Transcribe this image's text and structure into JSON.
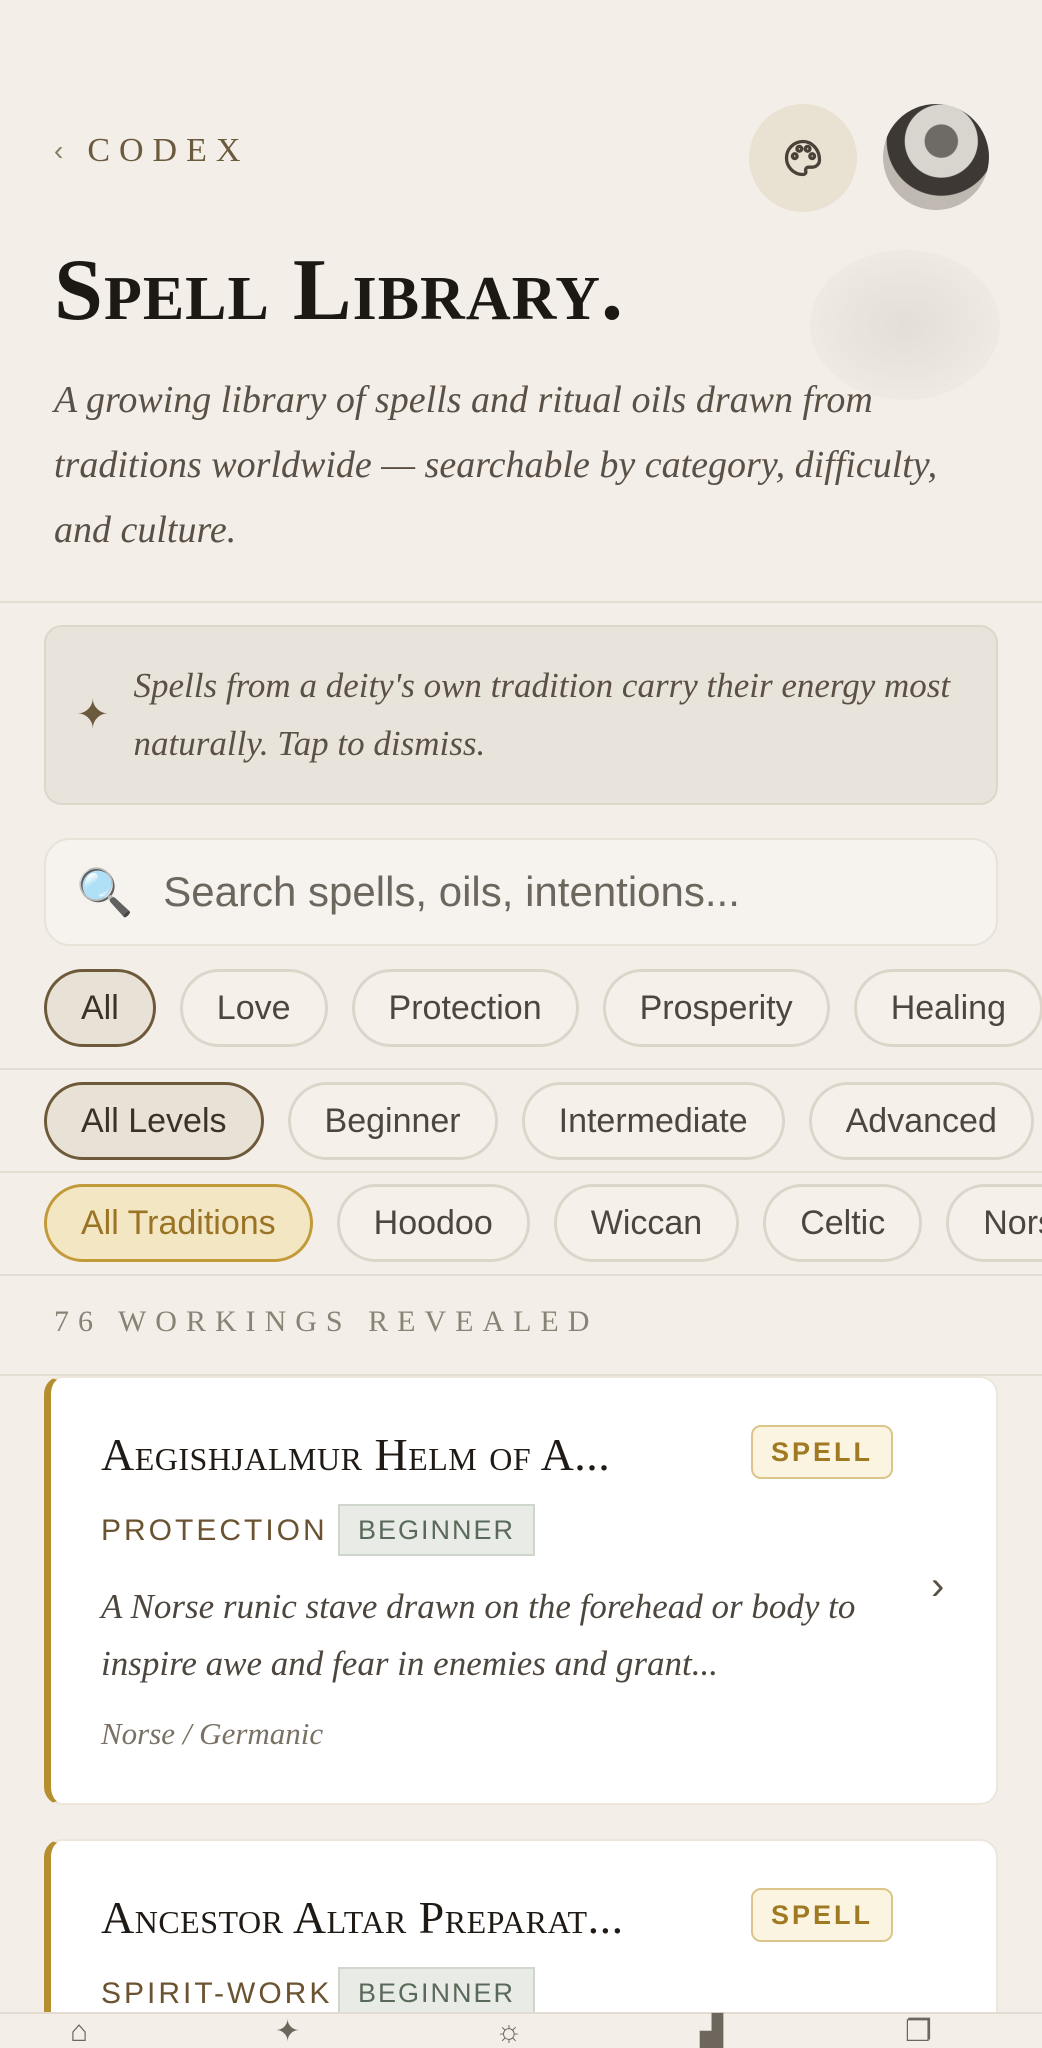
{
  "header": {
    "back_label": "CODEX",
    "back_chevron": "‹",
    "palette_icon": "palette-icon",
    "avatar_icon": "avatar"
  },
  "page": {
    "title": "Spell Library.",
    "subtitle": "A growing library of spells and ritual oils drawn from traditions worldwide — searchable by category, difficulty, and culture."
  },
  "tip": {
    "icon": "sparkle-icon",
    "text": "Spells from a deity's own tradition carry their energy most naturally. Tap to dismiss."
  },
  "search": {
    "placeholder": "Search spells, oils, intentions..."
  },
  "filters": {
    "categories": [
      "All",
      "Love",
      "Protection",
      "Prosperity",
      "Healing"
    ],
    "levels": [
      "All Levels",
      "Beginner",
      "Intermediate",
      "Advanced"
    ],
    "traditions": [
      "All Traditions",
      "Hoodoo",
      "Wiccan",
      "Celtic",
      "Nors"
    ]
  },
  "results": {
    "count_label": "76 WORKINGS REVEALED"
  },
  "cards": [
    {
      "title": "Aegishjalmur Helm of A...",
      "type": "SPELL",
      "category": "PROTECTION",
      "level": "BEGINNER",
      "description": "A Norse runic stave drawn on the forehead or body to inspire awe and fear in enemies and grant...",
      "tradition": "Norse / Germanic"
    },
    {
      "title": "Ancestor Altar Preparat...",
      "type": "SPELL",
      "category": "SPIRIT-WORK",
      "level": "BEGINNER"
    }
  ],
  "colors": {
    "background": "#f3efe8",
    "accent_gold": "#b58e2f",
    "card_bg": "#ffffff"
  }
}
